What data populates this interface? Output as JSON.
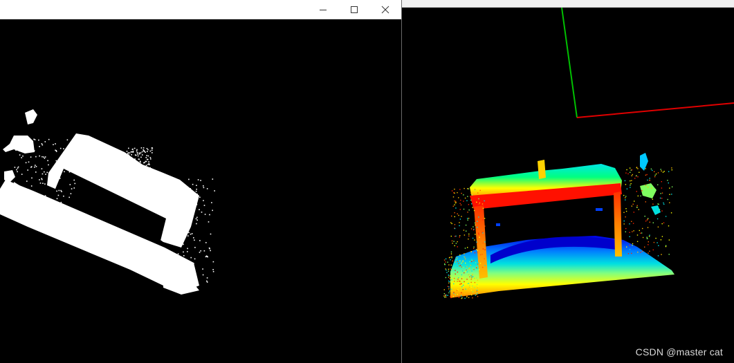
{
  "left_window": {
    "title_buttons": {
      "minimize_icon": "minimize-icon",
      "maximize_icon": "maximize-icon",
      "close_icon": "close-icon"
    },
    "content": "binary-mask-view"
  },
  "right_window": {
    "content": "point-cloud-3d-view",
    "axes": {
      "x_color": "#ff0000",
      "y_color": "#00ff00"
    }
  },
  "watermark": {
    "text": "CSDN @master cat"
  },
  "colors": {
    "background": "#000000",
    "mask": "#ffffff",
    "titlebar": "#ffffff"
  }
}
